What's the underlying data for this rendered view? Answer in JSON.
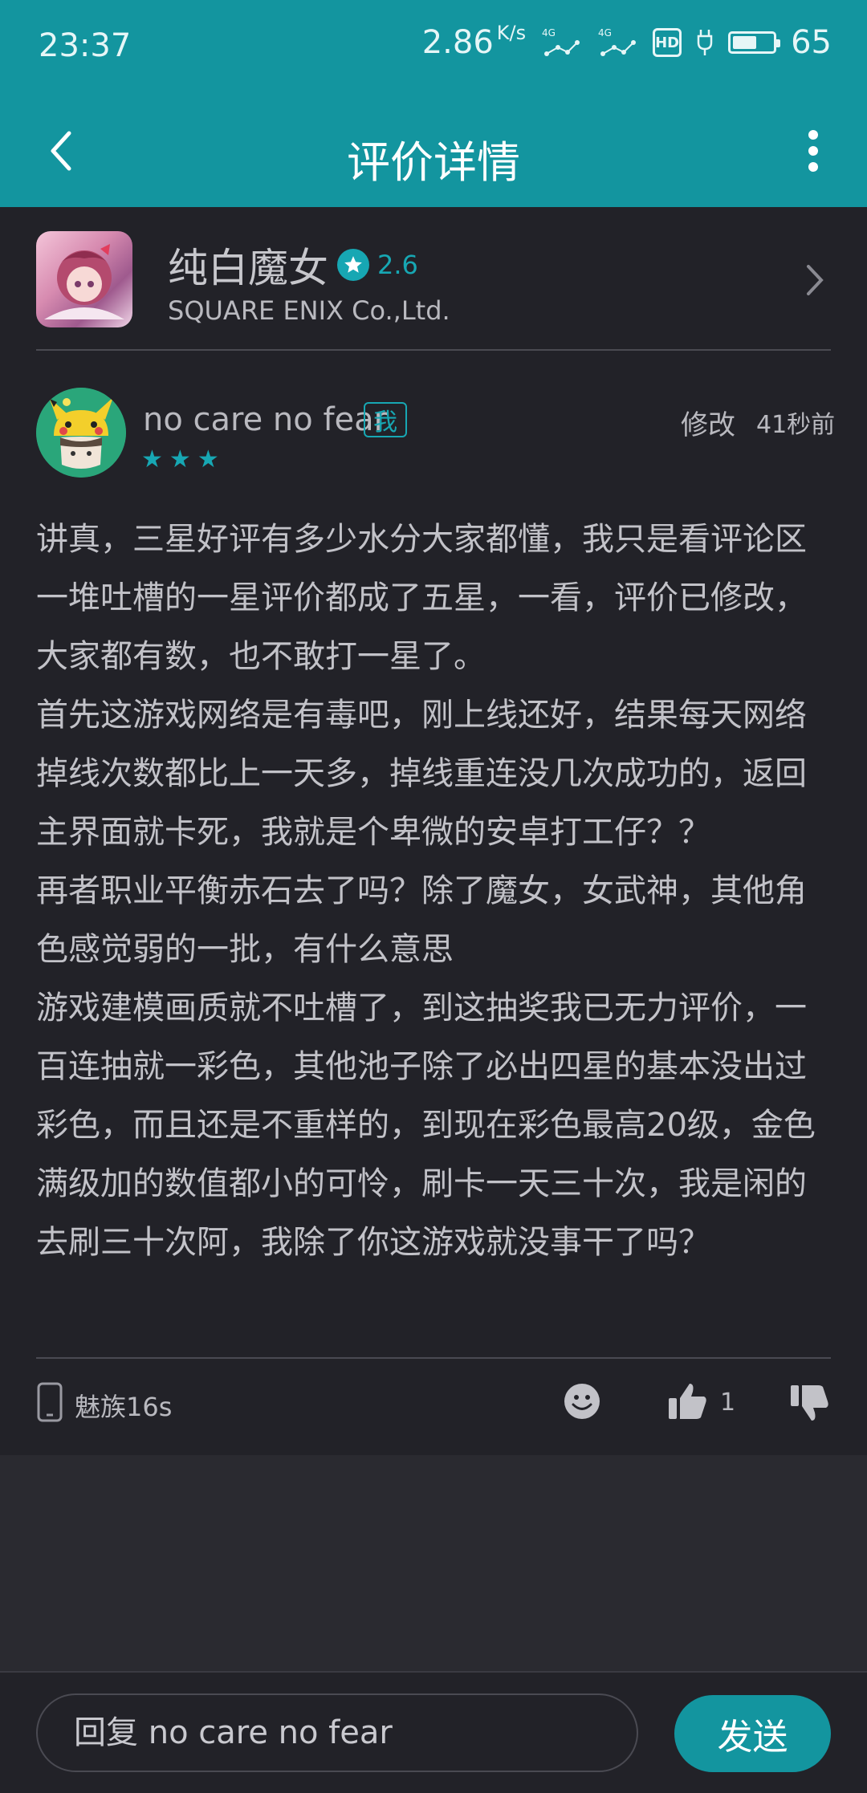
{
  "status_bar": {
    "time": "23:37",
    "speed": "2.86",
    "speed_unit": "K/s",
    "net1": "4G",
    "net2": "4G",
    "hd": "HD",
    "battery": "65",
    "battery_level": 0.65
  },
  "header": {
    "title": "评价详情",
    "back_icon": "back-arrow-icon",
    "more_icon": "more-vertical-icon"
  },
  "game": {
    "name": "纯白魔女",
    "rating": "2.6",
    "developer": "SQUARE ENIX Co.,Ltd."
  },
  "review": {
    "username": "no care no fear",
    "me_badge": "我",
    "stars": 3,
    "edit_label": "修改",
    "time": "41秒前",
    "paragraphs": [
      "讲真，三星好评有多少水分大家都懂，我只是看评论区一堆吐槽的一星评价都成了五星，一看，评价已修改，大家都有数，也不敢打一星了。",
      "首先这游戏网络是有毒吧，刚上线还好，结果每天网络掉线次数都比上一天多，掉线重连没几次成功的，返回主界面就卡死，我就是个卑微的安卓打工仔？？",
      "再者职业平衡赤石去了吗？除了魔女，女武神，其他角色感觉弱的一批，有什么意思",
      "游戏建模画质就不吐槽了，到这抽奖我已无力评价，一百连抽就一彩色，其他池子除了必出四星的基本没出过彩色，而且还是不重样的，到现在彩色最高20级，金色满级加的数值都小的可怜，刷卡一天三十次，我是闲的去刷三十次阿，我除了你这游戏就没事干了吗？"
    ],
    "device": "魅族16s",
    "like_count": "1"
  },
  "reply": {
    "placeholder": "回复 no care no fear",
    "send_label": "发送"
  },
  "colors": {
    "accent": "#13959f",
    "background": "#2a2a30",
    "card": "#222228"
  }
}
